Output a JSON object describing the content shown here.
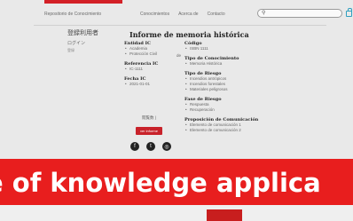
{
  "header": {
    "site_name": "Repositorio de Conocimiento",
    "nav": [
      "Conocimientos",
      "Acerca de",
      "Contacto"
    ]
  },
  "sidebar_ja": {
    "title": "登録利用者",
    "login": "ログイン",
    "register": "登録"
  },
  "record": {
    "title": "Informe de memoria histórica",
    "entity_label": "Entidad IC",
    "entity_values": [
      "Academia",
      "Protección Civil"
    ],
    "de_label": "de",
    "reference_label": "Referencia IC",
    "reference_values": [
      "IC-1111"
    ],
    "date_label": "Fecha IC",
    "date_values": [
      "2021-01-01"
    ],
    "code_label": "Código",
    "code_values": [
      "ISBN 1111"
    ],
    "type_label": "Tipo de Conocimiento",
    "type_values": [
      "Memoria Histórica"
    ],
    "risk_type_label": "Tipo de Riesgo",
    "risk_type_values": [
      "Incendios antrópicos",
      "Incendios forestales",
      "Materiales peligrosos"
    ],
    "risk_phase_label": "Fase de Riesgo",
    "risk_phase_values": [
      "Respuesta",
      "Recuperación"
    ],
    "purpose_label": "Proposición de Comunicación",
    "purpose_values": [
      "Elemento de comunicación 1",
      "Elemento de comunicación 2"
    ]
  },
  "share": {
    "label": "閲覧数 |",
    "button": "ver informe"
  },
  "social_icons": [
    "facebook-icon",
    "twitter-icon",
    "instagram-icon"
  ],
  "banner": {
    "text": "e of knowledge applica",
    "color": "#e81e1e"
  }
}
